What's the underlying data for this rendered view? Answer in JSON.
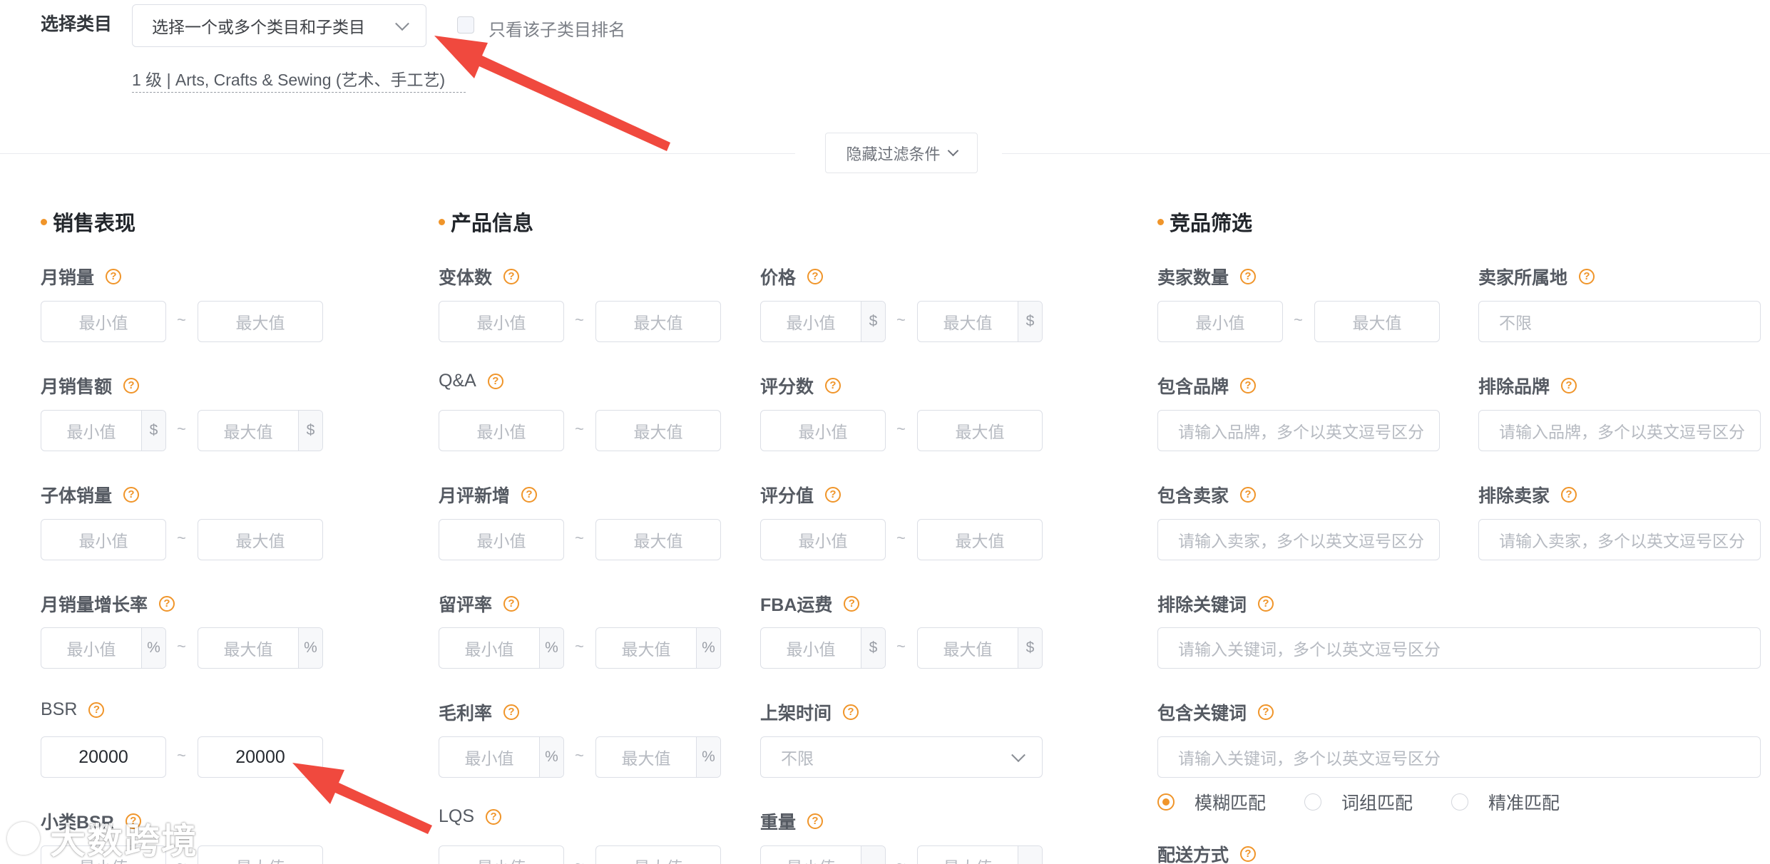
{
  "category": {
    "label": "选择类目",
    "select_placeholder": "选择一个或多个类目和子类目",
    "only_sub_label": "只看该子类目排名",
    "selected_path": "1 级 | Arts, Crafts & Sewing (艺术、手工艺)"
  },
  "toggle_filters_label": "隐藏过滤条件",
  "common": {
    "min": "最小值",
    "max": "最大值",
    "tilde": "~",
    "dollar": "$",
    "percent": "%",
    "q": "?"
  },
  "sales": {
    "title": "销售表现",
    "monthly_sales": "月销量",
    "monthly_revenue": "月销售额",
    "child_sales": "子体销量",
    "sales_growth": "月销量增长率",
    "bsr": "BSR",
    "bsr_min": "20000",
    "bsr_max": "20000",
    "sub_bsr": "小类BSR"
  },
  "product": {
    "title": "产品信息",
    "variants": "变体数",
    "qa": "Q&A",
    "monthly_new_reviews": "月评新增",
    "review_rate": "留评率",
    "gross_margin": "毛利率",
    "lqs": "LQS",
    "price": "价格",
    "rating_count": "评分数",
    "rating_value": "评分值",
    "fba_fee": "FBA运费",
    "listing_time": "上架时间",
    "listing_time_value": "不限",
    "weight": "重量"
  },
  "competitor": {
    "title": "竞品筛选",
    "seller_count": "卖家数量",
    "seller_location": "卖家所属地",
    "seller_location_value": "不限",
    "include_brand": "包含品牌",
    "exclude_brand": "排除品牌",
    "brand_placeholder": "请输入品牌，多个以英文逗号区分",
    "include_seller": "包含卖家",
    "exclude_seller": "排除卖家",
    "seller_placeholder": "请输入卖家，多个以英文逗号区分",
    "exclude_keyword": "排除关键词",
    "include_keyword": "包含关键词",
    "keyword_placeholder": "请输入关键词，多个以英文逗号区分",
    "match_fuzzy": "模糊匹配",
    "match_phrase": "词组匹配",
    "match_exact": "精准匹配",
    "delivery": "配送方式"
  },
  "watermark": "大数跨境",
  "colors": {
    "accent": "#f0952a",
    "arrow": "#f0493e"
  }
}
